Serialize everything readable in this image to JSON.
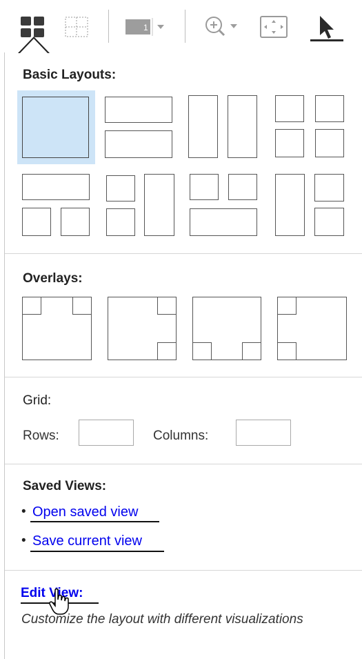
{
  "toolbar": {
    "layout_icon": "layout-grid-icon",
    "crosshair_icon": "grid-dashed-icon",
    "series_badge": "1",
    "zoom_icon": "zoom-in-icon",
    "fit_icon": "fit-to-window-icon",
    "pointer_icon": "pointer-arrow-icon"
  },
  "panel": {
    "basic_layouts": {
      "title": "Basic Layouts:"
    },
    "overlays": {
      "title": "Overlays:"
    },
    "grid": {
      "title": "Grid:",
      "rows_label": "Rows:",
      "rows_value": "",
      "columns_label": "Columns:",
      "columns_value": ""
    },
    "saved_views": {
      "title": "Saved Views:",
      "links": [
        {
          "label": "Open saved view"
        },
        {
          "label": "Save current view"
        }
      ]
    },
    "edit_view": {
      "link": "Edit View:",
      "description": "Customize the layout with different visualizations"
    }
  },
  "colors": {
    "selected_bg": "#cde4f7",
    "link": "#0000ee"
  }
}
